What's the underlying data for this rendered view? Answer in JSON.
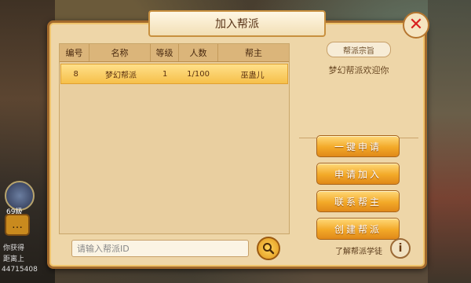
{
  "dialog": {
    "title": "加入帮派",
    "close_icon": "close-icon"
  },
  "table": {
    "headers": [
      "编号",
      "名称",
      "等级",
      "人数",
      "帮主"
    ],
    "rows": [
      {
        "id": "8",
        "name": "梦幻帮派",
        "level": "1",
        "members": "1/100",
        "leader": "巫蛊儿"
      }
    ]
  },
  "side": {
    "tenet_label": "帮派宗旨",
    "tenet_text": "梦幻帮派欢迎你"
  },
  "buttons": {
    "one_click": "一键申请",
    "apply": "申请加入",
    "contact": "联系帮主",
    "create": "创建帮派"
  },
  "search": {
    "placeholder": "请输入帮派ID",
    "icon": "search-icon"
  },
  "learn": {
    "label": "了解帮派学徒",
    "icon": "info-icon"
  },
  "background": {
    "avatar_label": "69級",
    "chat": [
      {
        "tag": "",
        "text": "你获得"
      },
      {
        "tag": "",
        "text": "距离上"
      },
      {
        "tag": "",
        "text": "44715408"
      }
    ]
  },
  "colors": {
    "accent": "#f3a928",
    "close": "#d81f1f",
    "row_highlight": "#f6c04a"
  }
}
